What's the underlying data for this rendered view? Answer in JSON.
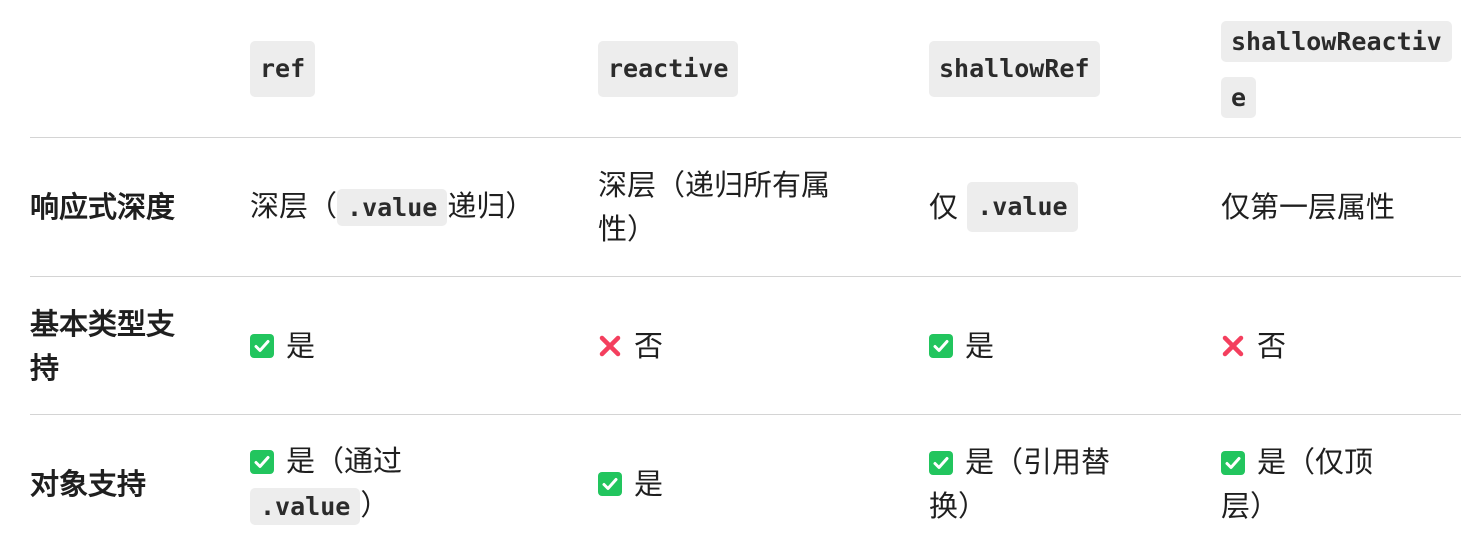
{
  "header": {
    "col1": "ref",
    "col2": "reactive",
    "col3": "shallowRef",
    "col4": "shallowReactive"
  },
  "rows": [
    {
      "label": "响应式深度",
      "ref": {
        "pre": "深层（",
        "code": ".value",
        "post": "递归）"
      },
      "reactive": "深层（递归所有属性）",
      "shallowRef": {
        "pre": "仅 ",
        "code": ".value"
      },
      "shallowReactive": "仅第一层属性"
    },
    {
      "label": "基本类型支持",
      "ref": {
        "icon": "check-icon",
        "text": "是"
      },
      "reactive": {
        "icon": "cross-icon",
        "text": "否"
      },
      "shallowRef": {
        "icon": "check-icon",
        "text": "是"
      },
      "shallowReactive": {
        "icon": "cross-icon",
        "text": "否"
      }
    },
    {
      "label": "对象支持",
      "ref": {
        "icon": "check-icon",
        "pre": "是（通过",
        "code": ".value",
        "post": "）"
      },
      "reactive": {
        "icon": "check-icon",
        "text": "是"
      },
      "shallowRef": {
        "icon": "check-icon",
        "text": "是（引用替换）"
      },
      "shallowReactive": {
        "icon": "check-icon",
        "text": "是（仅顶层）"
      }
    }
  ],
  "colors": {
    "check": "#22c55e",
    "cross": "#f43f5e",
    "code_bg": "#ededed",
    "divider": "#d4d4d4"
  }
}
